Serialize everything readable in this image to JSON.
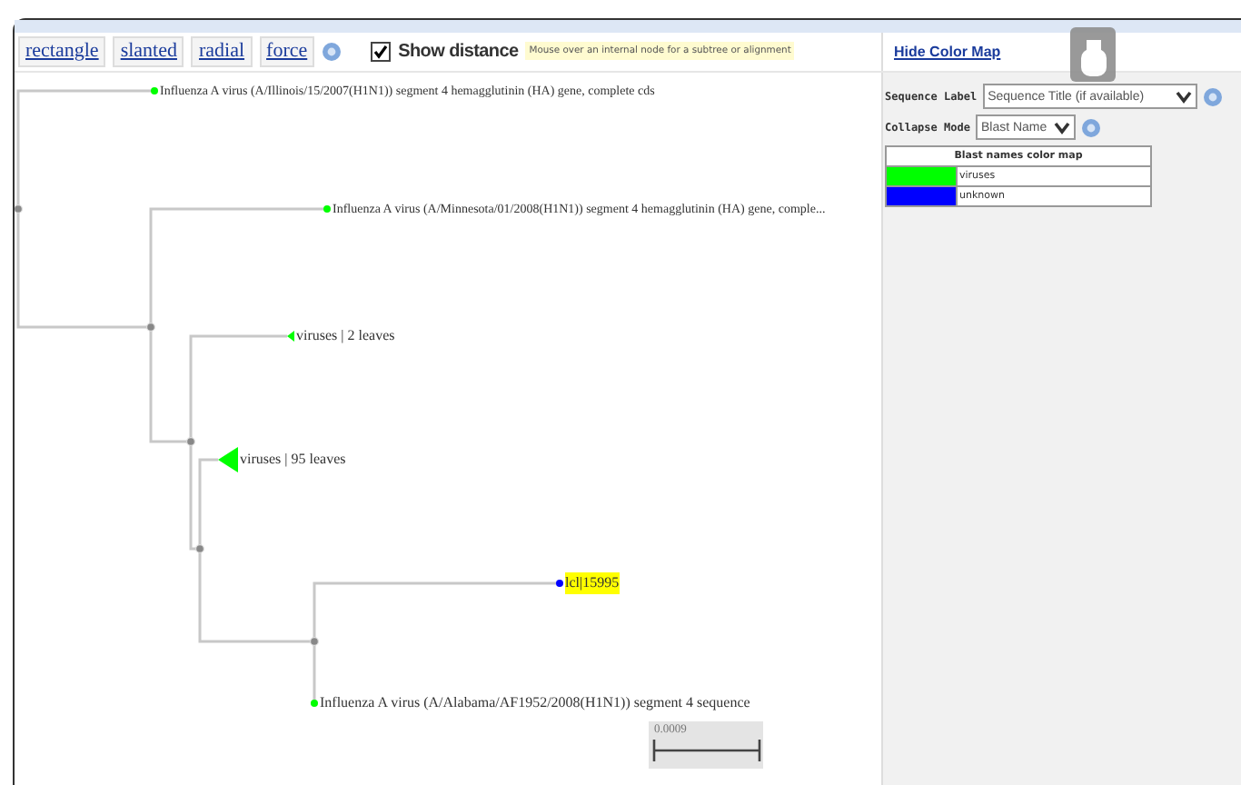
{
  "toolbar": {
    "layouts": [
      {
        "label": "rectangle"
      },
      {
        "label": "slanted"
      },
      {
        "label": "radial"
      },
      {
        "label": "force"
      }
    ],
    "show_distance": {
      "label": "Show distance",
      "checked": true
    },
    "hint": "Mouse over an internal node for a subtree or alignment"
  },
  "color_map_toggle": "Hide Color Map",
  "options": [
    {
      "label": "Sequence Label",
      "value": "Sequence Title (if available)"
    },
    {
      "label": "Collapse Mode",
      "value": "Blast Name"
    }
  ],
  "color_map": {
    "title": "Blast names color map",
    "rows": [
      {
        "name": "viruses",
        "color": "#00ff00"
      },
      {
        "name": "unknown",
        "color": "#0000ff"
      }
    ]
  },
  "tree": {
    "children": [
      {
        "kind": "leaf",
        "label": "Influenza A virus (A/Illinois/15/2007(H1N1)) segment 4 hemagglutinin (HA) gene, complete cds",
        "color": "#00ff00",
        "highlighted": false
      },
      {
        "children": [
          {
            "kind": "leaf",
            "label": "Influenza A virus (A/Minnesota/01/2008(H1N1)) segment 4 hemagglutinin (HA) gene, comple...",
            "color": "#00ff00",
            "highlighted": false
          },
          {
            "children": [
              {
                "kind": "collapsed",
                "label": "viruses | 2 leaves",
                "color": "#00ff00",
                "highlighted": false
              },
              {
                "children": [
                  {
                    "kind": "collapsed",
                    "label": "viruses | 95 leaves",
                    "color": "#00ff00",
                    "highlighted": false
                  },
                  {
                    "children": [
                      {
                        "kind": "leaf",
                        "label": "lcl|15995",
                        "color": "#0000ff",
                        "highlighted": true
                      },
                      {
                        "kind": "leaf",
                        "label": "Influenza A virus (A/Alabama/AF1952/2008(H1N1)) segment 4 sequence",
                        "color": "#00ff00",
                        "highlighted": false
                      }
                    ]
                  }
                ]
              }
            ]
          }
        ]
      }
    ]
  },
  "scale_bar": {
    "label": "0.0009"
  }
}
